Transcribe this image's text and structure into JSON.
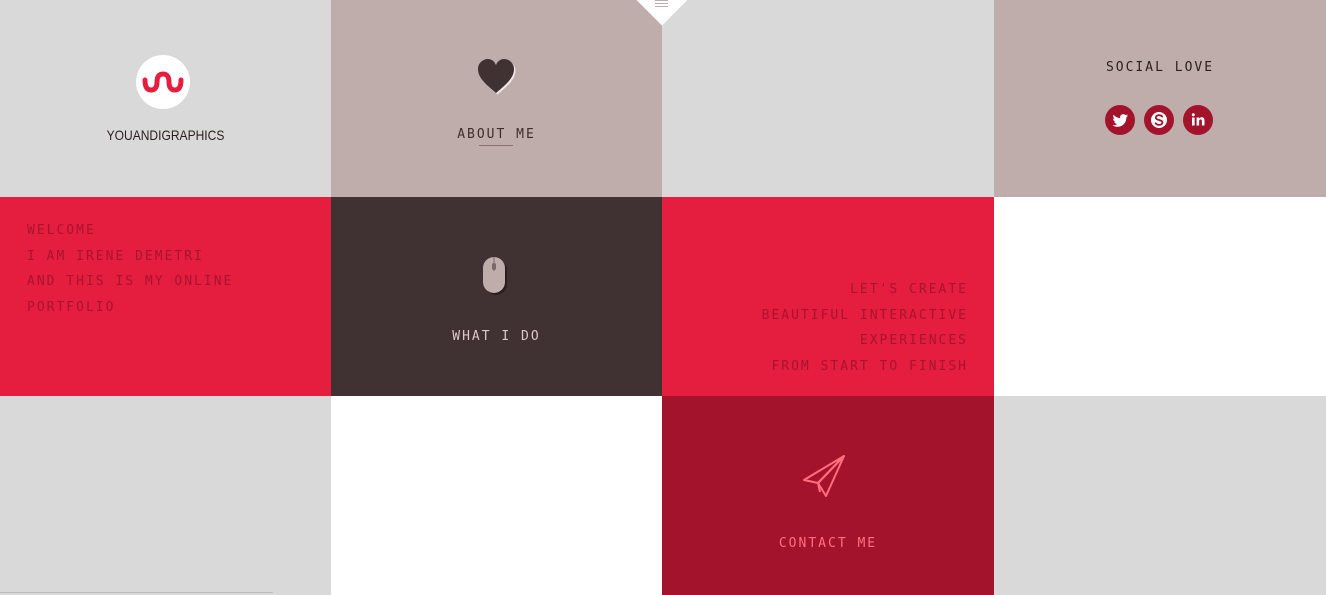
{
  "brand": {
    "name": "YOUANDIGRAPHICS",
    "logo_icon": "ui-logo-icon",
    "logo_color": "#e51d3e"
  },
  "nav": {
    "menu_icon": "hamburger-menu-icon"
  },
  "about": {
    "label": "ABOUT ME",
    "icon": "heart-icon"
  },
  "social": {
    "title": "SOCIAL LOVE",
    "items": [
      {
        "name": "twitter",
        "icon": "twitter-icon"
      },
      {
        "name": "skype",
        "icon": "skype-icon"
      },
      {
        "name": "linkedin",
        "icon": "linkedin-icon"
      }
    ]
  },
  "welcome": {
    "lines": [
      "WELCOME",
      "I AM IRENE DEMETRI",
      "AND THIS IS MY ONLINE",
      "PORTFOLIO"
    ]
  },
  "services": {
    "label": "WHAT I DO",
    "icon": "mouse-icon"
  },
  "tagline": {
    "lines": [
      "LET'S CREATE",
      "BEAUTIFUL INTERACTIVE",
      "EXPERIENCES",
      "FROM START TO FINISH"
    ]
  },
  "contact": {
    "label": "CONTACT ME",
    "icon": "paper-plane-icon"
  },
  "colors": {
    "grey": "#d9d9d9",
    "mauve": "#bfadab",
    "red": "#e51d3e",
    "dark": "#403232",
    "crimson": "#a3142c",
    "white": "#ffffff"
  }
}
